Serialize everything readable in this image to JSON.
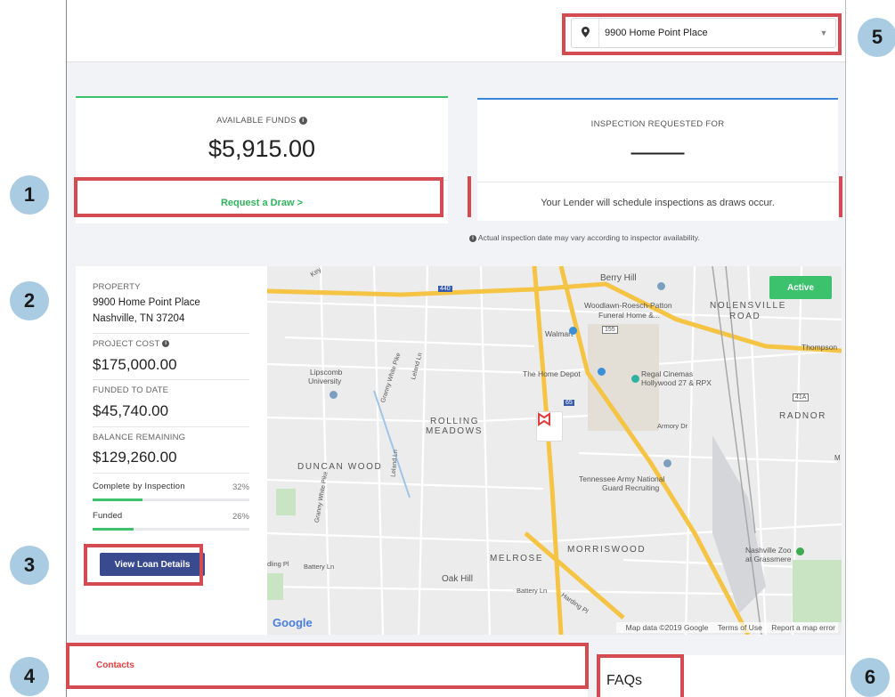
{
  "callouts": [
    "1",
    "2",
    "3",
    "4",
    "5",
    "6"
  ],
  "header": {
    "address": "9900 Home Point Place"
  },
  "funds": {
    "label": "AVAILABLE FUNDS",
    "amount": "$5,915.00",
    "action": "Request a Draw >"
  },
  "inspection": {
    "label": "INSPECTION REQUESTED FOR",
    "value": "——",
    "message": "Your Lender will schedule inspections as draws occur.",
    "note": "Actual inspection date may vary according to inspector availability."
  },
  "property": {
    "label": "PROPERTY",
    "line1": "9900 Home Point Place",
    "line2": "Nashville, TN 37204",
    "project_cost_label": "PROJECT COST",
    "project_cost": "$175,000.00",
    "funded_label": "FUNDED TO DATE",
    "funded": "$45,740.00",
    "balance_label": "BALANCE REMAINING",
    "balance": "$129,260.00",
    "inspection_progress_label": "Complete by Inspection",
    "inspection_progress_pct": "32%",
    "inspection_progress_value": 0.32,
    "funded_progress_label": "Funded",
    "funded_progress_pct": "26%",
    "funded_progress_value": 0.26,
    "button": "View Loan Details"
  },
  "map": {
    "status": "Active",
    "labels": {
      "berry_hill": "Berry Hill",
      "nolensville": "NOLENSVILLE",
      "road": "ROAD",
      "woodlawn1": "Woodlawn-Roesch-Patton",
      "woodlawn2": "Funeral Home &...",
      "walmart": "Walmart",
      "thompson": "Thompson",
      "lipscomb1": "Lipscomb",
      "lipscomb2": "University",
      "home_depot": "The Home Depot",
      "regal1": "Regal Cinemas",
      "regal2": "Hollywood 27 & RPX",
      "radnor": "RADNOR",
      "rolling1": "ROLLING",
      "rolling2": "MEADOWS",
      "armory": "Armory Dr",
      "duncan": "DUNCAN WOOD",
      "tn_army1": "Tennessee Army National",
      "tn_army2": "Guard Recruiting",
      "morriswood": "MORRISWOOD",
      "melrose": "MELROSE",
      "oak_hill": "Oak Hill",
      "zoo1": "Nashville Zoo",
      "zoo2": "at Grassmere",
      "battery": "Battery Ln",
      "battery2": "Battery Ln",
      "granny": "Granny White Pike",
      "granny2": "Granny White Pike",
      "leland": "Leland Ln",
      "leland2": "Leland Ln",
      "harding": "Harding Pl",
      "dling": "dling Pl",
      "key": "Key",
      "hwy440": "440",
      "hwy155": "155",
      "hwy65": "65",
      "hwy41a": "41A",
      "m": "M"
    },
    "google": "Google",
    "attribution": {
      "data": "Map data ©2019 Google",
      "terms": "Terms of Use",
      "report": "Report a map error"
    }
  },
  "contacts": {
    "label": "Contacts"
  },
  "faq": {
    "label": "FAQs"
  },
  "colors": {
    "accent_green": "#3cc26c",
    "accent_blue": "#3a86d8",
    "button_navy": "#394a8e",
    "highlight_red": "#d54b52",
    "callout_blue": "#a9cce3"
  }
}
